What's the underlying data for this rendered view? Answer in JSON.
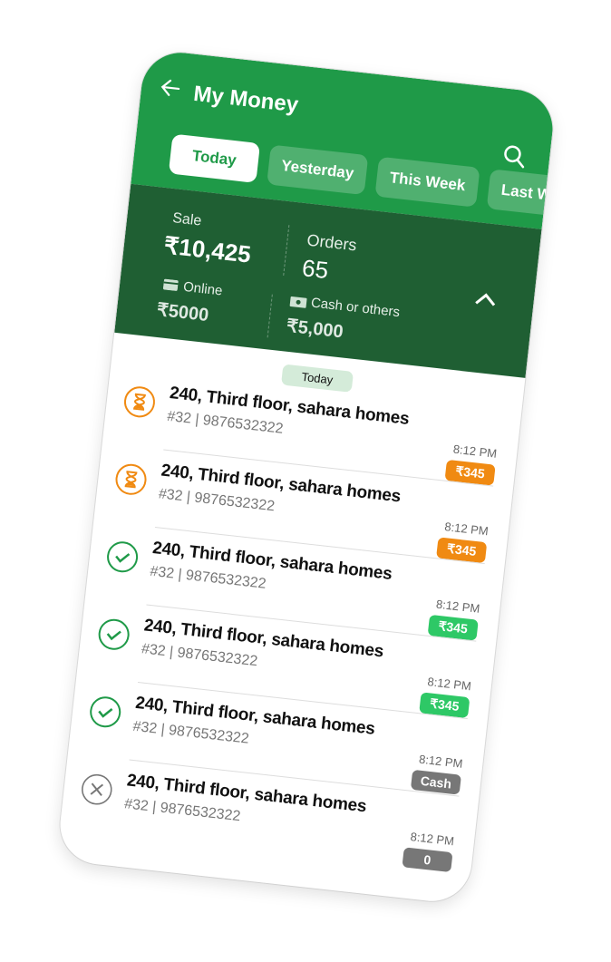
{
  "header": {
    "title": "My Money",
    "back_icon": "arrow-left-icon",
    "search_icon": "search-icon"
  },
  "tabs": [
    {
      "label": "Today",
      "active": true
    },
    {
      "label": "Yesterday"
    },
    {
      "label": "This Week"
    },
    {
      "label": "Last W"
    }
  ],
  "summary": {
    "sale_label": "Sale",
    "sale_value": "₹10,425",
    "orders_label": "Orders",
    "orders_value": "65",
    "online_label": "Online",
    "online_value": "₹5000",
    "cash_label": "Cash or others",
    "cash_value": "₹5,000"
  },
  "list": {
    "date_chip": "Today",
    "rows": [
      {
        "address": "240, Third floor, sahara homes",
        "sub": "#32 | 9876532322",
        "time": "8:12 PM",
        "amount": "₹345",
        "status": "pending",
        "color": "#f08a12"
      },
      {
        "address": "240, Third floor, sahara homes",
        "sub": "#32 | 9876532322",
        "time": "8:12 PM",
        "amount": "₹345",
        "status": "pending",
        "color": "#f08a12"
      },
      {
        "address": "240, Third floor, sahara homes",
        "sub": "#32 | 9876532322",
        "time": "8:12 PM",
        "amount": "₹345",
        "status": "done",
        "color": "#2ec866"
      },
      {
        "address": "240, Third floor, sahara homes",
        "sub": "#32 | 9876532322",
        "time": "8:12 PM",
        "amount": "₹345",
        "status": "done",
        "color": "#2ec866"
      },
      {
        "address": "240, Third floor, sahara homes",
        "sub": "#32 | 9876532322",
        "time": "8:12 PM",
        "amount": "Cash",
        "status": "done",
        "color": "#777777"
      },
      {
        "address": "240, Third floor, sahara homes",
        "sub": "#32 | 9876532322",
        "time": "8:12 PM",
        "amount": "0",
        "status": "cancelled",
        "color": "#777777"
      }
    ]
  }
}
